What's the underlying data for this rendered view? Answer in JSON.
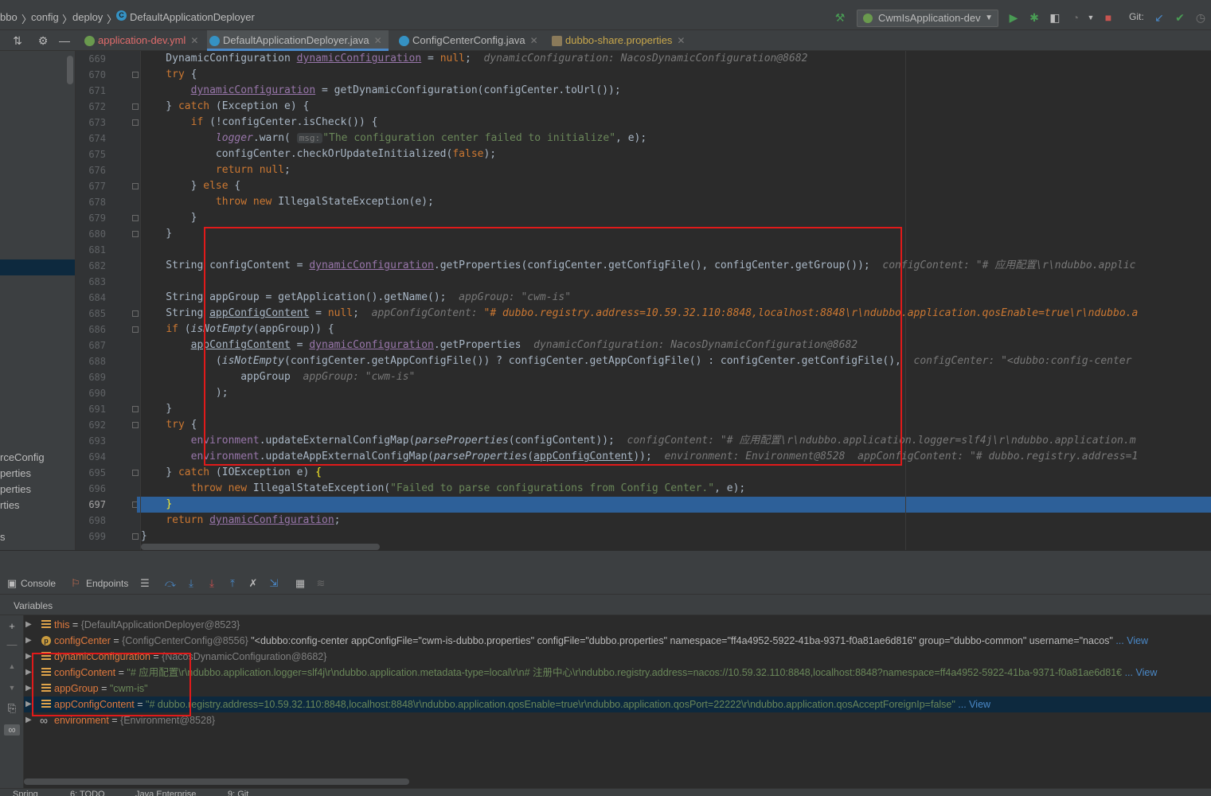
{
  "breadcrumb": [
    "bbo",
    "config",
    "deploy",
    "DefaultApplicationDeployer"
  ],
  "toolbar": {
    "run_config": "CwmIsApplication-dev",
    "git_label": "Git:"
  },
  "tabs": [
    {
      "label": "application-dev.yml",
      "color": "#e06c6c",
      "active": false,
      "icon": "yaml-icon"
    },
    {
      "label": "DefaultApplicationDeployer.java",
      "color": "#bbbbbb",
      "active": true,
      "icon": "class-icon"
    },
    {
      "label": "ConfigCenterConfig.java",
      "color": "#bbbbbb",
      "active": false,
      "icon": "class-icon"
    },
    {
      "label": "dubbo-share.properties",
      "color": "#c9a84c",
      "active": false,
      "icon": "properties-icon"
    }
  ],
  "left_panel": {
    "items": [
      "rceConfig",
      "perties",
      "perties",
      "rties",
      "s"
    ]
  },
  "code": {
    "line_numbers": [
      "669",
      "670",
      "671",
      "672",
      "673",
      "674",
      "675",
      "676",
      "677",
      "678",
      "679",
      "680",
      "681",
      "682",
      "683",
      "684",
      "685",
      "686",
      "687",
      "688",
      "689",
      "690",
      "691",
      "692",
      "693",
      "694",
      "695",
      "696",
      "697",
      "698",
      "699"
    ],
    "current_line": "697",
    "hints": {
      "h669": "dynamicConfiguration: NacosDynamicConfiguration@8682",
      "h682": "configContent: \"# 应用配置\\r\\ndubbo.applic",
      "h684": "appGroup: \"cwm-is\"",
      "h685_label": "appConfigContent: ",
      "h685_value": "\"# dubbo.registry.address=10.59.32.110:8848,localhost:8848\\r\\ndubbo.application.qosEnable=true\\r\\ndubbo.a",
      "h687": "dynamicConfiguration: NacosDynamicConfiguration@8682",
      "h688": "configCenter: \"<dubbo:config-center",
      "h689": "appGroup: \"cwm-is\"",
      "h693": "configContent: \"# 应用配置\\r\\ndubbo.application.logger=slf4j\\r\\ndubbo.application.m",
      "h694a": "environment: Environment@8528",
      "h694b": "appConfigContent: \"# dubbo.registry.address=1",
      "msg_param": "msg:"
    }
  },
  "debug_toolbar": {
    "console": "Console",
    "endpoints": "Endpoints"
  },
  "variables": {
    "title": "Variables",
    "rows": [
      {
        "name": "this",
        "icon": "field",
        "value": "{DefaultApplicationDeployer@8523}",
        "value_style": "gray",
        "extra": "",
        "link": "",
        "expandable": true,
        "selected": false
      },
      {
        "name": "configCenter",
        "icon": "prot",
        "value": "{ConfigCenterConfig@8556}",
        "value_style": "gray",
        "extra": " \"<dubbo:config-center appConfigFile=\"cwm-is-dubbo.properties\" configFile=\"dubbo.properties\" namespace=\"ff4a4952-5922-41ba-9371-f0a81ae6d816\" group=\"dubbo-common\" username=\"nacos\"",
        "link": " ... View",
        "expandable": true,
        "selected": false
      },
      {
        "name": "dynamicConfiguration",
        "icon": "field",
        "value": "{NacosDynamicConfiguration@8682}",
        "value_style": "gray",
        "extra": "",
        "link": "",
        "expandable": true,
        "selected": false
      },
      {
        "name": "configContent",
        "icon": "field",
        "value": "\"# 应用配置\\r\\ndubbo.application.logger=slf4j\\r\\ndubbo.application.metadata-type=local\\r\\n# 注册中心\\r\\ndubbo.registry.address=nacos://10.59.32.110:8848,localhost:8848?namespace=ff4a4952-5922-41ba-9371-f0a81ae6d81€",
        "value_style": "green",
        "extra": "",
        "link": " ... View",
        "expandable": true,
        "selected": false
      },
      {
        "name": "appGroup",
        "icon": "field",
        "value": "\"cwm-is\"",
        "value_style": "green",
        "extra": "",
        "link": "",
        "expandable": true,
        "selected": false
      },
      {
        "name": "appConfigContent",
        "icon": "field",
        "value": "\"# dubbo.registry.address=10.59.32.110:8848,localhost:8848\\r\\ndubbo.application.qosEnable=true\\r\\ndubbo.application.qosPort=22222\\r\\ndubbo.application.qosAcceptForeignIp=false\"",
        "value_style": "green",
        "extra": "",
        "link": " ... View",
        "expandable": true,
        "selected": true
      },
      {
        "name": "environment",
        "icon": "inf",
        "value": "{Environment@8528}",
        "value_style": "gray",
        "extra": "",
        "link": "",
        "expandable": true,
        "selected": false
      }
    ]
  },
  "status_bar": [
    "Spring",
    "6: TODO",
    "Java Enterprise",
    "9: Git"
  ],
  "colors": {
    "highlight_box": "#e01a1a",
    "current_line": "#2d6099",
    "selected_row": "#0d293e",
    "run_green": "#499c54",
    "stop_red": "#c75450",
    "accent_blue": "#4a88c7"
  }
}
